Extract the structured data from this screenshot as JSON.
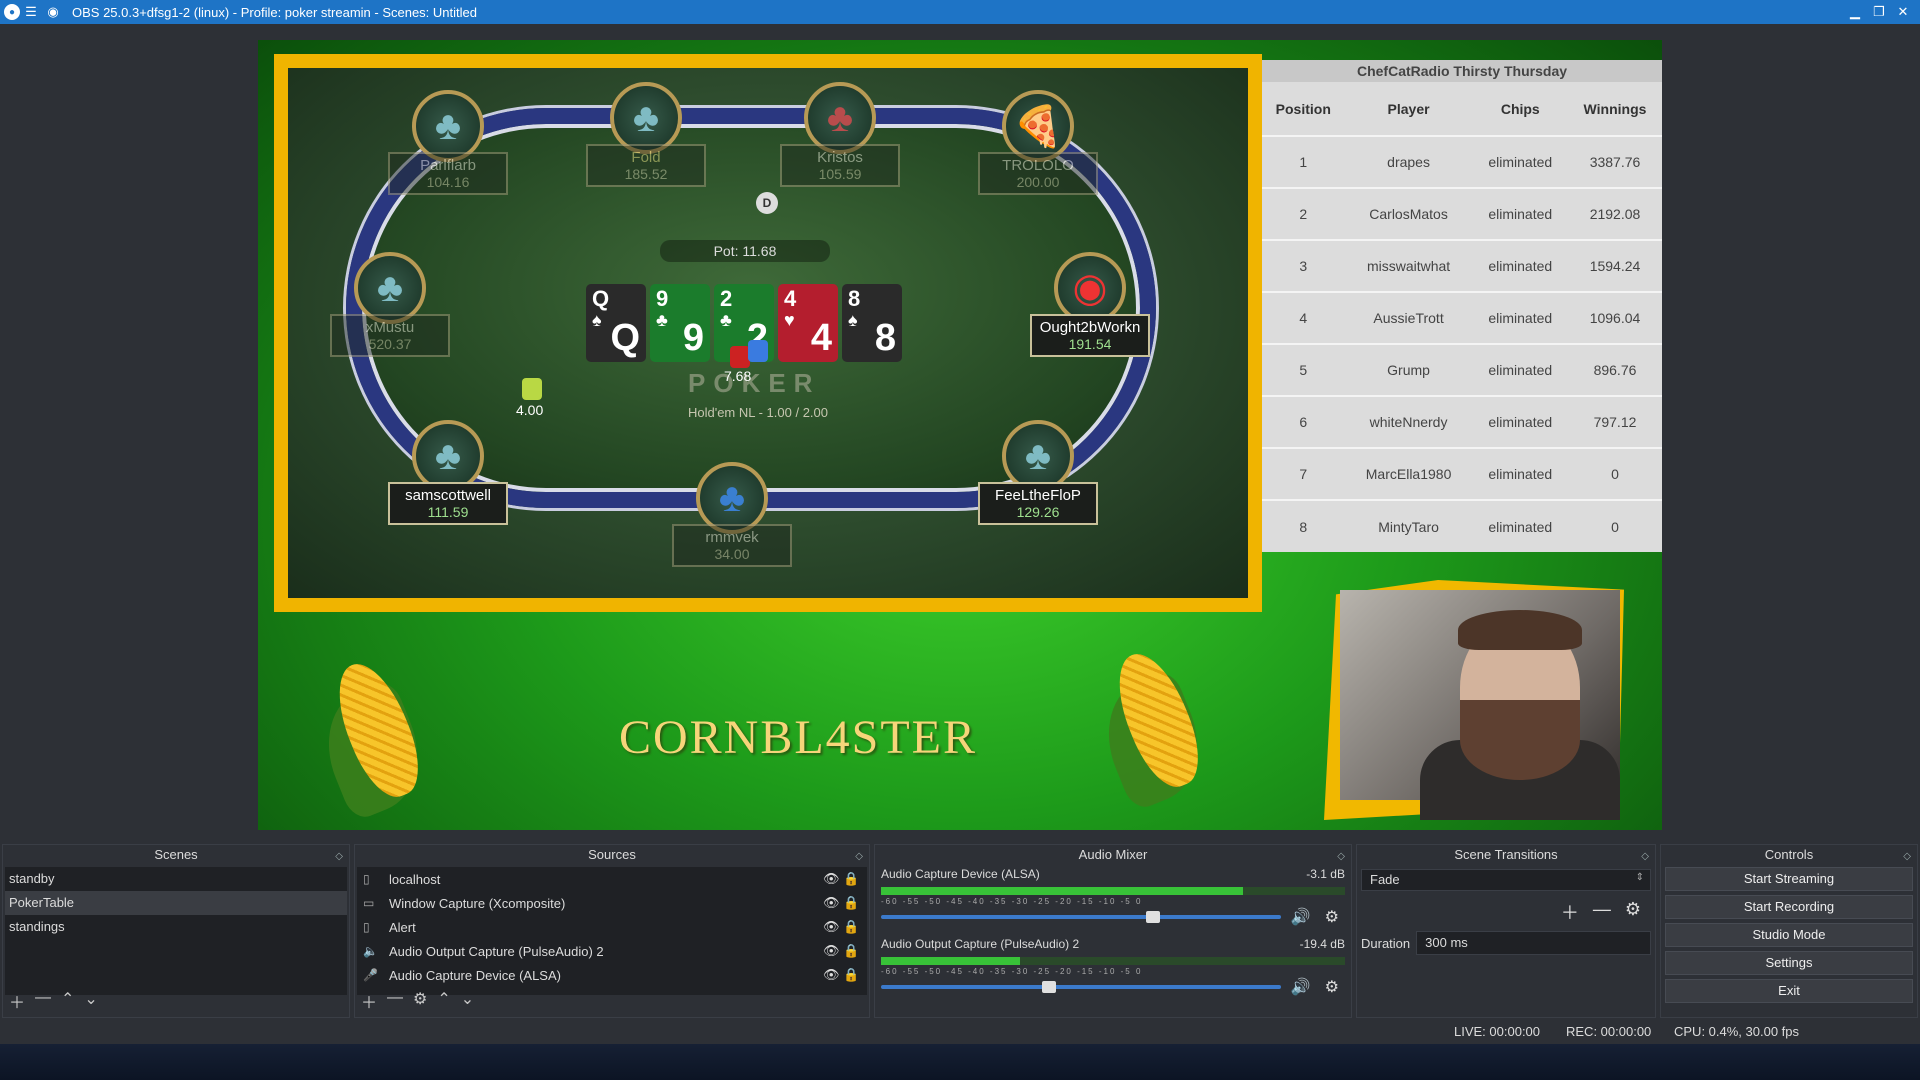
{
  "window": {
    "title": "OBS 25.0.3+dfsg1-2 (linux) - Profile: poker streamin - Scenes: Untitled"
  },
  "table": {
    "pot": "Pot: 11.68",
    "dealer": "D",
    "logo": "POKER",
    "game": "Hold'em NL - 1.00 / 2.00",
    "bet_center": "7.68",
    "bet_left": "4.00",
    "players": [
      {
        "name": "Parlflarb",
        "chips": "104.16"
      },
      {
        "name": "Fold",
        "chips": "185.52"
      },
      {
        "name": "Kristos",
        "chips": "105.59"
      },
      {
        "name": "TROLOLO",
        "chips": "200.00"
      },
      {
        "name": "xMustu",
        "chips": "520.37"
      },
      {
        "name": "Ought2bWorkn",
        "chips": "191.54"
      },
      {
        "name": "samscottwell",
        "chips": "111.59"
      },
      {
        "name": "rmmvek",
        "chips": "34.00"
      },
      {
        "name": "FeeLtheFloP",
        "chips": "129.26"
      }
    ],
    "board": [
      {
        "rank": "Q",
        "suit": "♠",
        "color": "dark"
      },
      {
        "rank": "9",
        "suit": "♣",
        "color": "green"
      },
      {
        "rank": "2",
        "suit": "♣",
        "color": "green"
      },
      {
        "rank": "4",
        "suit": "♥",
        "color": "red"
      },
      {
        "rank": "8",
        "suit": "♠",
        "color": "dark"
      }
    ]
  },
  "standings": {
    "title": "ChefCatRadio Thirsty Thursday",
    "headers": [
      "Position",
      "Player",
      "Chips",
      "Winnings"
    ],
    "rows": [
      [
        "1",
        "drapes",
        "eliminated",
        "3387.76"
      ],
      [
        "2",
        "CarlosMatos",
        "eliminated",
        "2192.08"
      ],
      [
        "3",
        "misswaitwhat",
        "eliminated",
        "1594.24"
      ],
      [
        "4",
        "AussieTrott",
        "eliminated",
        "1096.04"
      ],
      [
        "5",
        "Grump",
        "eliminated",
        "896.76"
      ],
      [
        "6",
        "whiteNnerdy",
        "eliminated",
        "797.12"
      ],
      [
        "7",
        "MarcElla1980",
        "eliminated",
        "0"
      ],
      [
        "8",
        "MintyTaro",
        "eliminated",
        "0"
      ]
    ]
  },
  "branding": {
    "text": "CORNBL4STER"
  },
  "docks": {
    "scenes": {
      "title": "Scenes",
      "items": [
        "standby",
        "PokerTable",
        "standings"
      ],
      "selected": 1
    },
    "sources": {
      "title": "Sources",
      "items": [
        {
          "name": "localhost",
          "icon": "document-icon"
        },
        {
          "name": "Window Capture (Xcomposite)",
          "icon": "window-icon"
        },
        {
          "name": "Alert",
          "icon": "document-icon"
        },
        {
          "name": "Audio Output Capture (PulseAudio) 2",
          "icon": "speaker-icon"
        },
        {
          "name": "Audio Capture Device (ALSA)",
          "icon": "microphone-icon"
        }
      ]
    },
    "mixer": {
      "title": "Audio Mixer",
      "channels": [
        {
          "name": "Audio Capture Device (ALSA)",
          "db": "-3.1 dB",
          "level": 0.78,
          "volume": 0.68
        },
        {
          "name": "Audio Output Capture (PulseAudio) 2",
          "db": "-19.4 dB",
          "level": 0.3,
          "volume": 0.42
        }
      ],
      "ticks": "-60  -55  -50  -45  -40  -35  -30  -25  -20  -15  -10  -5  0"
    },
    "transitions": {
      "title": "Scene Transitions",
      "selected": "Fade",
      "duration_label": "Duration",
      "duration": "300 ms"
    },
    "controls": {
      "title": "Controls",
      "buttons": [
        "Start Streaming",
        "Start Recording",
        "Studio Mode",
        "Settings",
        "Exit"
      ]
    }
  },
  "status": {
    "live": "LIVE: 00:00:00",
    "rec": "REC: 00:00:00",
    "cpu": "CPU: 0.4%, 30.00 fps"
  }
}
